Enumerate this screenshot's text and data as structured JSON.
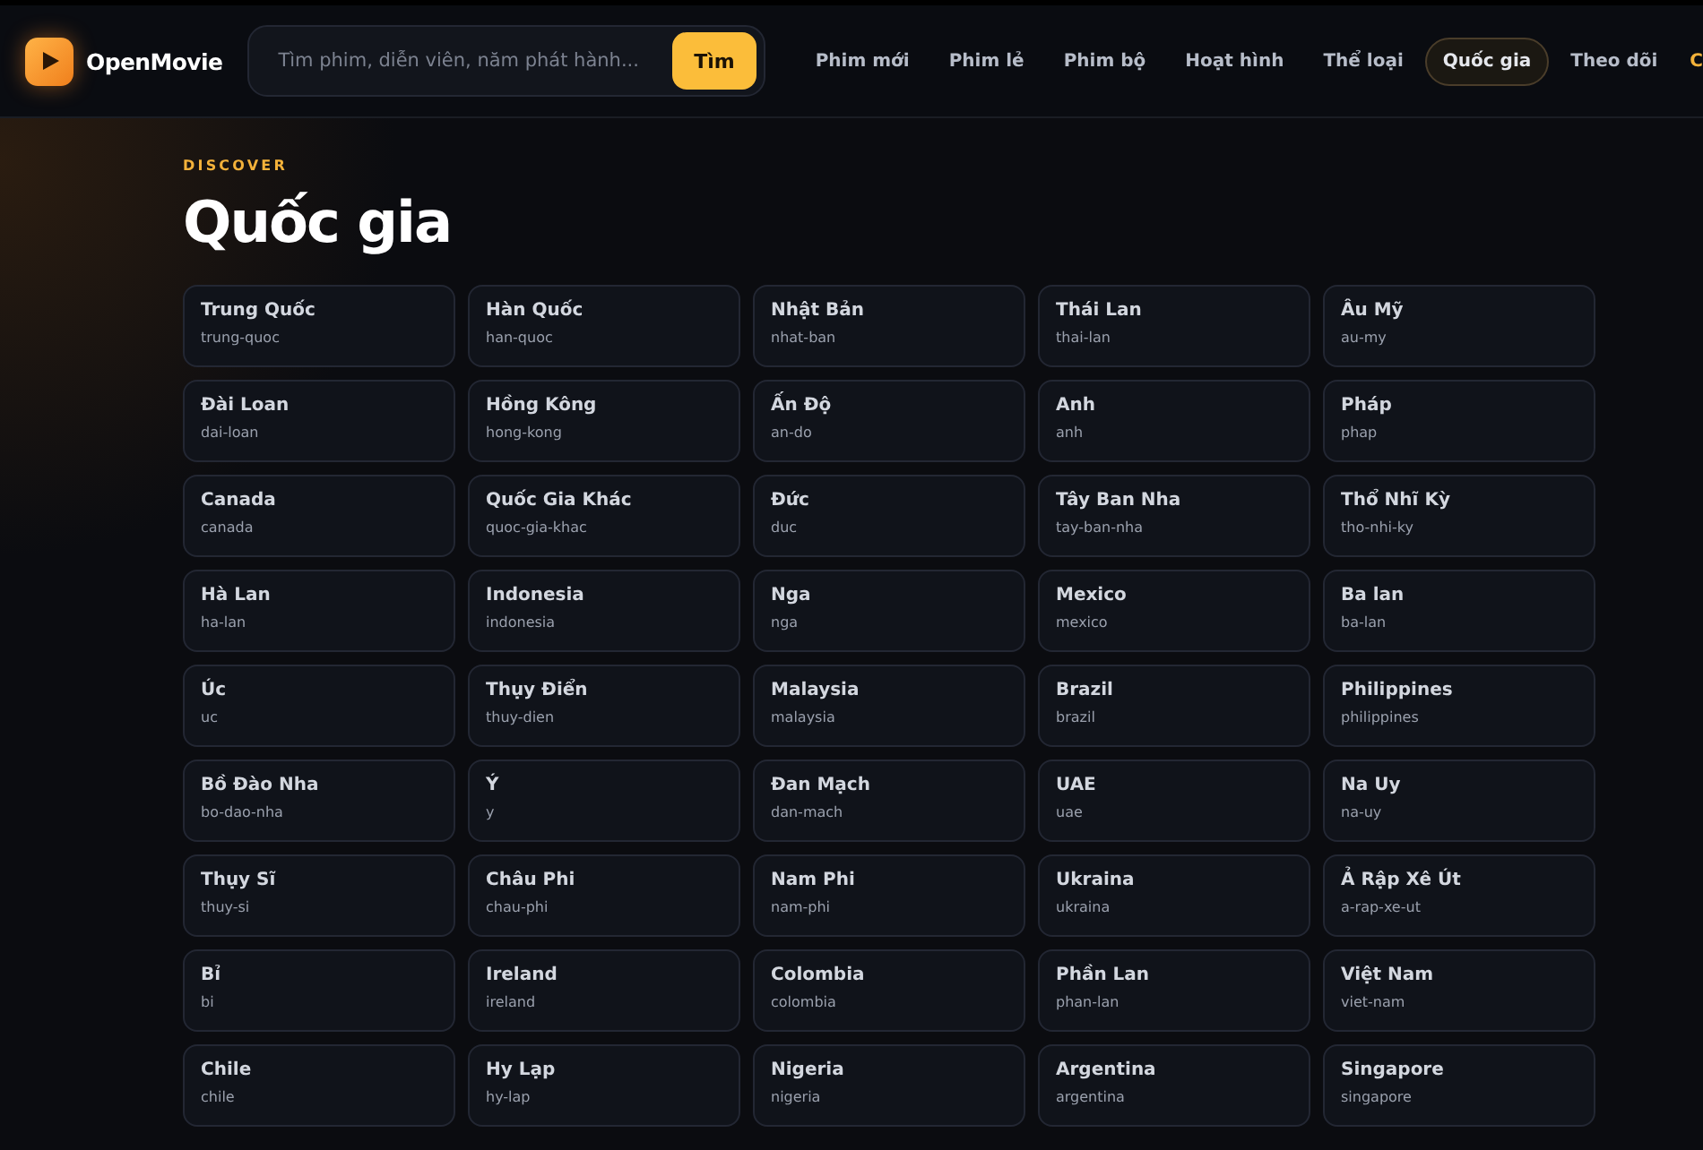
{
  "header": {
    "logo": "OpenMovie",
    "search": {
      "placeholder": "Tìm phim, diễn viên, năm phát hành...",
      "button": "Tìm"
    },
    "nav": [
      {
        "label": "Phim mới",
        "selected": false
      },
      {
        "label": "Phim lẻ",
        "selected": false
      },
      {
        "label": "Phim bộ",
        "selected": false
      },
      {
        "label": "Hoạt hình",
        "selected": false
      },
      {
        "label": "Thể loại",
        "selected": false
      },
      {
        "label": "Quốc gia",
        "selected": true
      },
      {
        "label": "Theo dõi",
        "selected": false
      }
    ],
    "cut_link": "C"
  },
  "eyebrow": "DISCOVER",
  "title": "Quốc gia",
  "countries": [
    {
      "name": "Trung Quốc",
      "slug": "trung-quoc"
    },
    {
      "name": "Hàn Quốc",
      "slug": "han-quoc"
    },
    {
      "name": "Nhật Bản",
      "slug": "nhat-ban"
    },
    {
      "name": "Thái Lan",
      "slug": "thai-lan"
    },
    {
      "name": "Âu Mỹ",
      "slug": "au-my"
    },
    {
      "name": "Đài Loan",
      "slug": "dai-loan"
    },
    {
      "name": "Hồng Kông",
      "slug": "hong-kong"
    },
    {
      "name": "Ấn Độ",
      "slug": "an-do"
    },
    {
      "name": "Anh",
      "slug": "anh"
    },
    {
      "name": "Pháp",
      "slug": "phap"
    },
    {
      "name": "Canada",
      "slug": "canada"
    },
    {
      "name": "Quốc Gia Khác",
      "slug": "quoc-gia-khac"
    },
    {
      "name": "Đức",
      "slug": "duc"
    },
    {
      "name": "Tây Ban Nha",
      "slug": "tay-ban-nha"
    },
    {
      "name": "Thổ Nhĩ Kỳ",
      "slug": "tho-nhi-ky"
    },
    {
      "name": "Hà Lan",
      "slug": "ha-lan"
    },
    {
      "name": "Indonesia",
      "slug": "indonesia"
    },
    {
      "name": "Nga",
      "slug": "nga"
    },
    {
      "name": "Mexico",
      "slug": "mexico"
    },
    {
      "name": "Ba lan",
      "slug": "ba-lan"
    },
    {
      "name": "Úc",
      "slug": "uc"
    },
    {
      "name": "Thụy Điển",
      "slug": "thuy-dien"
    },
    {
      "name": "Malaysia",
      "slug": "malaysia"
    },
    {
      "name": "Brazil",
      "slug": "brazil"
    },
    {
      "name": "Philippines",
      "slug": "philippines"
    },
    {
      "name": "Bồ Đào Nha",
      "slug": "bo-dao-nha"
    },
    {
      "name": "Ý",
      "slug": "y"
    },
    {
      "name": "Đan Mạch",
      "slug": "dan-mach"
    },
    {
      "name": "UAE",
      "slug": "uae"
    },
    {
      "name": "Na Uy",
      "slug": "na-uy"
    },
    {
      "name": "Thụy Sĩ",
      "slug": "thuy-si"
    },
    {
      "name": "Châu Phi",
      "slug": "chau-phi"
    },
    {
      "name": "Nam Phi",
      "slug": "nam-phi"
    },
    {
      "name": "Ukraina",
      "slug": "ukraina"
    },
    {
      "name": "Ả Rập Xê Út",
      "slug": "a-rap-xe-ut"
    },
    {
      "name": "Bỉ",
      "slug": "bi"
    },
    {
      "name": "Ireland",
      "slug": "ireland"
    },
    {
      "name": "Colombia",
      "slug": "colombia"
    },
    {
      "name": "Phần Lan",
      "slug": "phan-lan"
    },
    {
      "name": "Việt Nam",
      "slug": "viet-nam"
    },
    {
      "name": "Chile",
      "slug": "chile"
    },
    {
      "name": "Hy Lạp",
      "slug": "hy-lap"
    },
    {
      "name": "Nigeria",
      "slug": "nigeria"
    },
    {
      "name": "Argentina",
      "slug": "argentina"
    },
    {
      "name": "Singapore",
      "slug": "singapore"
    }
  ]
}
